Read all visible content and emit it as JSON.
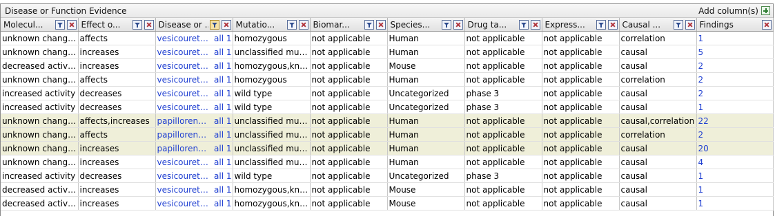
{
  "panel": {
    "title": "Disease or Function Evidence",
    "add_columns_label": "Add column(s)"
  },
  "columns": [
    {
      "label": "Molecul..."
    },
    {
      "label": "Effect o..."
    },
    {
      "label": "Disease or ..."
    },
    {
      "label": "Mutatio..."
    },
    {
      "label": "Biomar..."
    },
    {
      "label": "Species..."
    },
    {
      "label": "Drug ta..."
    },
    {
      "label": "Express..."
    },
    {
      "label": "Causal ..."
    },
    {
      "label": "Findings"
    }
  ],
  "rows": [
    {
      "mol": "unknown change...",
      "effect": "affects",
      "disease": "vesicourete...",
      "all": "all 1",
      "mutation": "homozygous",
      "biomarker": "not applicable",
      "species": "Human",
      "drug": "not applicable",
      "expression": "not applicable",
      "causal": "correlation",
      "findings": "1",
      "highlight": false
    },
    {
      "mol": "unknown change...",
      "effect": "increases",
      "disease": "vesicourete...",
      "all": "all 1",
      "mutation": "unclassified muta...",
      "biomarker": "not applicable",
      "species": "Human",
      "drug": "not applicable",
      "expression": "not applicable",
      "causal": "causal",
      "findings": "5",
      "highlight": false
    },
    {
      "mol": "decreased activity",
      "effect": "increases",
      "disease": "vesicourete...",
      "all": "all 1",
      "mutation": "homozygous,kno...",
      "biomarker": "not applicable",
      "species": "Mouse",
      "drug": "not applicable",
      "expression": "not applicable",
      "causal": "causal",
      "findings": "2",
      "highlight": false
    },
    {
      "mol": "unknown change...",
      "effect": "affects",
      "disease": "vesicourete...",
      "all": "all 1",
      "mutation": "homozygous",
      "biomarker": "not applicable",
      "species": "Human",
      "drug": "not applicable",
      "expression": "not applicable",
      "causal": "correlation",
      "findings": "2",
      "highlight": false
    },
    {
      "mol": "increased activity",
      "effect": "decreases",
      "disease": "vesicourete...",
      "all": "all 1",
      "mutation": "wild type",
      "biomarker": "not applicable",
      "species": "Uncategorized",
      "drug": "phase 3",
      "expression": "not applicable",
      "causal": "causal",
      "findings": "2",
      "highlight": false
    },
    {
      "mol": "increased activity",
      "effect": "decreases",
      "disease": "vesicourete...",
      "all": "all 1",
      "mutation": "wild type",
      "biomarker": "not applicable",
      "species": "Uncategorized",
      "drug": "phase 3",
      "expression": "not applicable",
      "causal": "causal",
      "findings": "1",
      "highlight": false
    },
    {
      "mol": "unknown change...",
      "effect": "affects,increases",
      "disease": "papillorenal...",
      "all": "all 1",
      "mutation": "unclassified muta...",
      "biomarker": "not applicable",
      "species": "Human",
      "drug": "not applicable",
      "expression": "not applicable",
      "causal": "causal,correlation",
      "findings": "22",
      "highlight": true
    },
    {
      "mol": "unknown change...",
      "effect": "affects",
      "disease": "papillorenal...",
      "all": "all 1",
      "mutation": "unclassified muta...",
      "biomarker": "not applicable",
      "species": "Human",
      "drug": "not applicable",
      "expression": "not applicable",
      "causal": "correlation",
      "findings": "2",
      "highlight": true
    },
    {
      "mol": "unknown change...",
      "effect": "increases",
      "disease": "papillorenal...",
      "all": "all 1",
      "mutation": "unclassified muta...",
      "biomarker": "not applicable",
      "species": "Human",
      "drug": "not applicable",
      "expression": "not applicable",
      "causal": "causal",
      "findings": "20",
      "highlight": true
    },
    {
      "mol": "unknown change...",
      "effect": "increases",
      "disease": "vesicourete...",
      "all": "all 1",
      "mutation": "unclassified muta...",
      "biomarker": "not applicable",
      "species": "Human",
      "drug": "not applicable",
      "expression": "not applicable",
      "causal": "causal",
      "findings": "4",
      "highlight": false
    },
    {
      "mol": "increased activity",
      "effect": "decreases",
      "disease": "vesicourete...",
      "all": "all 1",
      "mutation": "wild type",
      "biomarker": "not applicable",
      "species": "Uncategorized",
      "drug": "phase 3",
      "expression": "not applicable",
      "causal": "causal",
      "findings": "1",
      "highlight": false
    },
    {
      "mol": "decreased activity",
      "effect": "increases",
      "disease": "vesicourete...",
      "all": "all 1",
      "mutation": "homozygous,kno...",
      "biomarker": "not applicable",
      "species": "Mouse",
      "drug": "not applicable",
      "expression": "not applicable",
      "causal": "causal",
      "findings": "1",
      "highlight": false
    },
    {
      "mol": "decreased activity",
      "effect": "increases",
      "disease": "vesicourete...",
      "all": "all 1",
      "mutation": "homozygous,kno...",
      "biomarker": "not applicable",
      "species": "Mouse",
      "drug": "not applicable",
      "expression": "not applicable",
      "causal": "causal",
      "findings": "1",
      "highlight": false
    }
  ],
  "colors": {
    "link": "#1f3fd1",
    "highlight_row": "#efefd9",
    "active_filter": "#f6e2a6"
  }
}
